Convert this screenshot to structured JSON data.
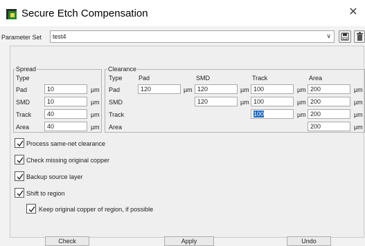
{
  "window": {
    "title": "Secure Etch Compensation",
    "app_icon": "app-icon",
    "close_glyph": "✕"
  },
  "parameter_set": {
    "label": "Parameter Set",
    "value": "test4",
    "save_icon": "save-icon",
    "delete_icon": "delete-icon"
  },
  "spread": {
    "title": "Spread",
    "type_label": "Type",
    "rows": [
      {
        "label": "Pad",
        "value": "10",
        "unit": "µm"
      },
      {
        "label": "SMD",
        "value": "10",
        "unit": "µm"
      },
      {
        "label": "Track",
        "value": "40",
        "unit": "µm"
      },
      {
        "label": "Area",
        "value": "40",
        "unit": "µm"
      }
    ]
  },
  "clearance": {
    "title": "Clearance",
    "type_label": "Type",
    "columns": [
      "Pad",
      "SMD",
      "Track",
      "Area"
    ],
    "unit": "µm",
    "rows": [
      {
        "label": "Pad",
        "pad": "120",
        "smd": "120",
        "track": "100",
        "area": "200"
      },
      {
        "label": "SMD",
        "smd": "120",
        "track": "100",
        "area": "200"
      },
      {
        "label": "Track",
        "track": "100",
        "area": "200"
      },
      {
        "label": "Area",
        "area": "200"
      }
    ]
  },
  "options": [
    {
      "label": "Process same-net clearance",
      "checked": true
    },
    {
      "label": "Check missing original copper",
      "checked": true
    },
    {
      "label": "Backup source layer",
      "checked": true
    },
    {
      "label": "Shift to region",
      "checked": true
    },
    {
      "label": "Keep original copper of region, if possible",
      "checked": true
    }
  ],
  "buttons": {
    "check": "Check",
    "apply": "Apply",
    "undo": "Undo"
  },
  "colors": {
    "selection": "#1565c0",
    "app_icon_green": "#1f8a2c"
  }
}
